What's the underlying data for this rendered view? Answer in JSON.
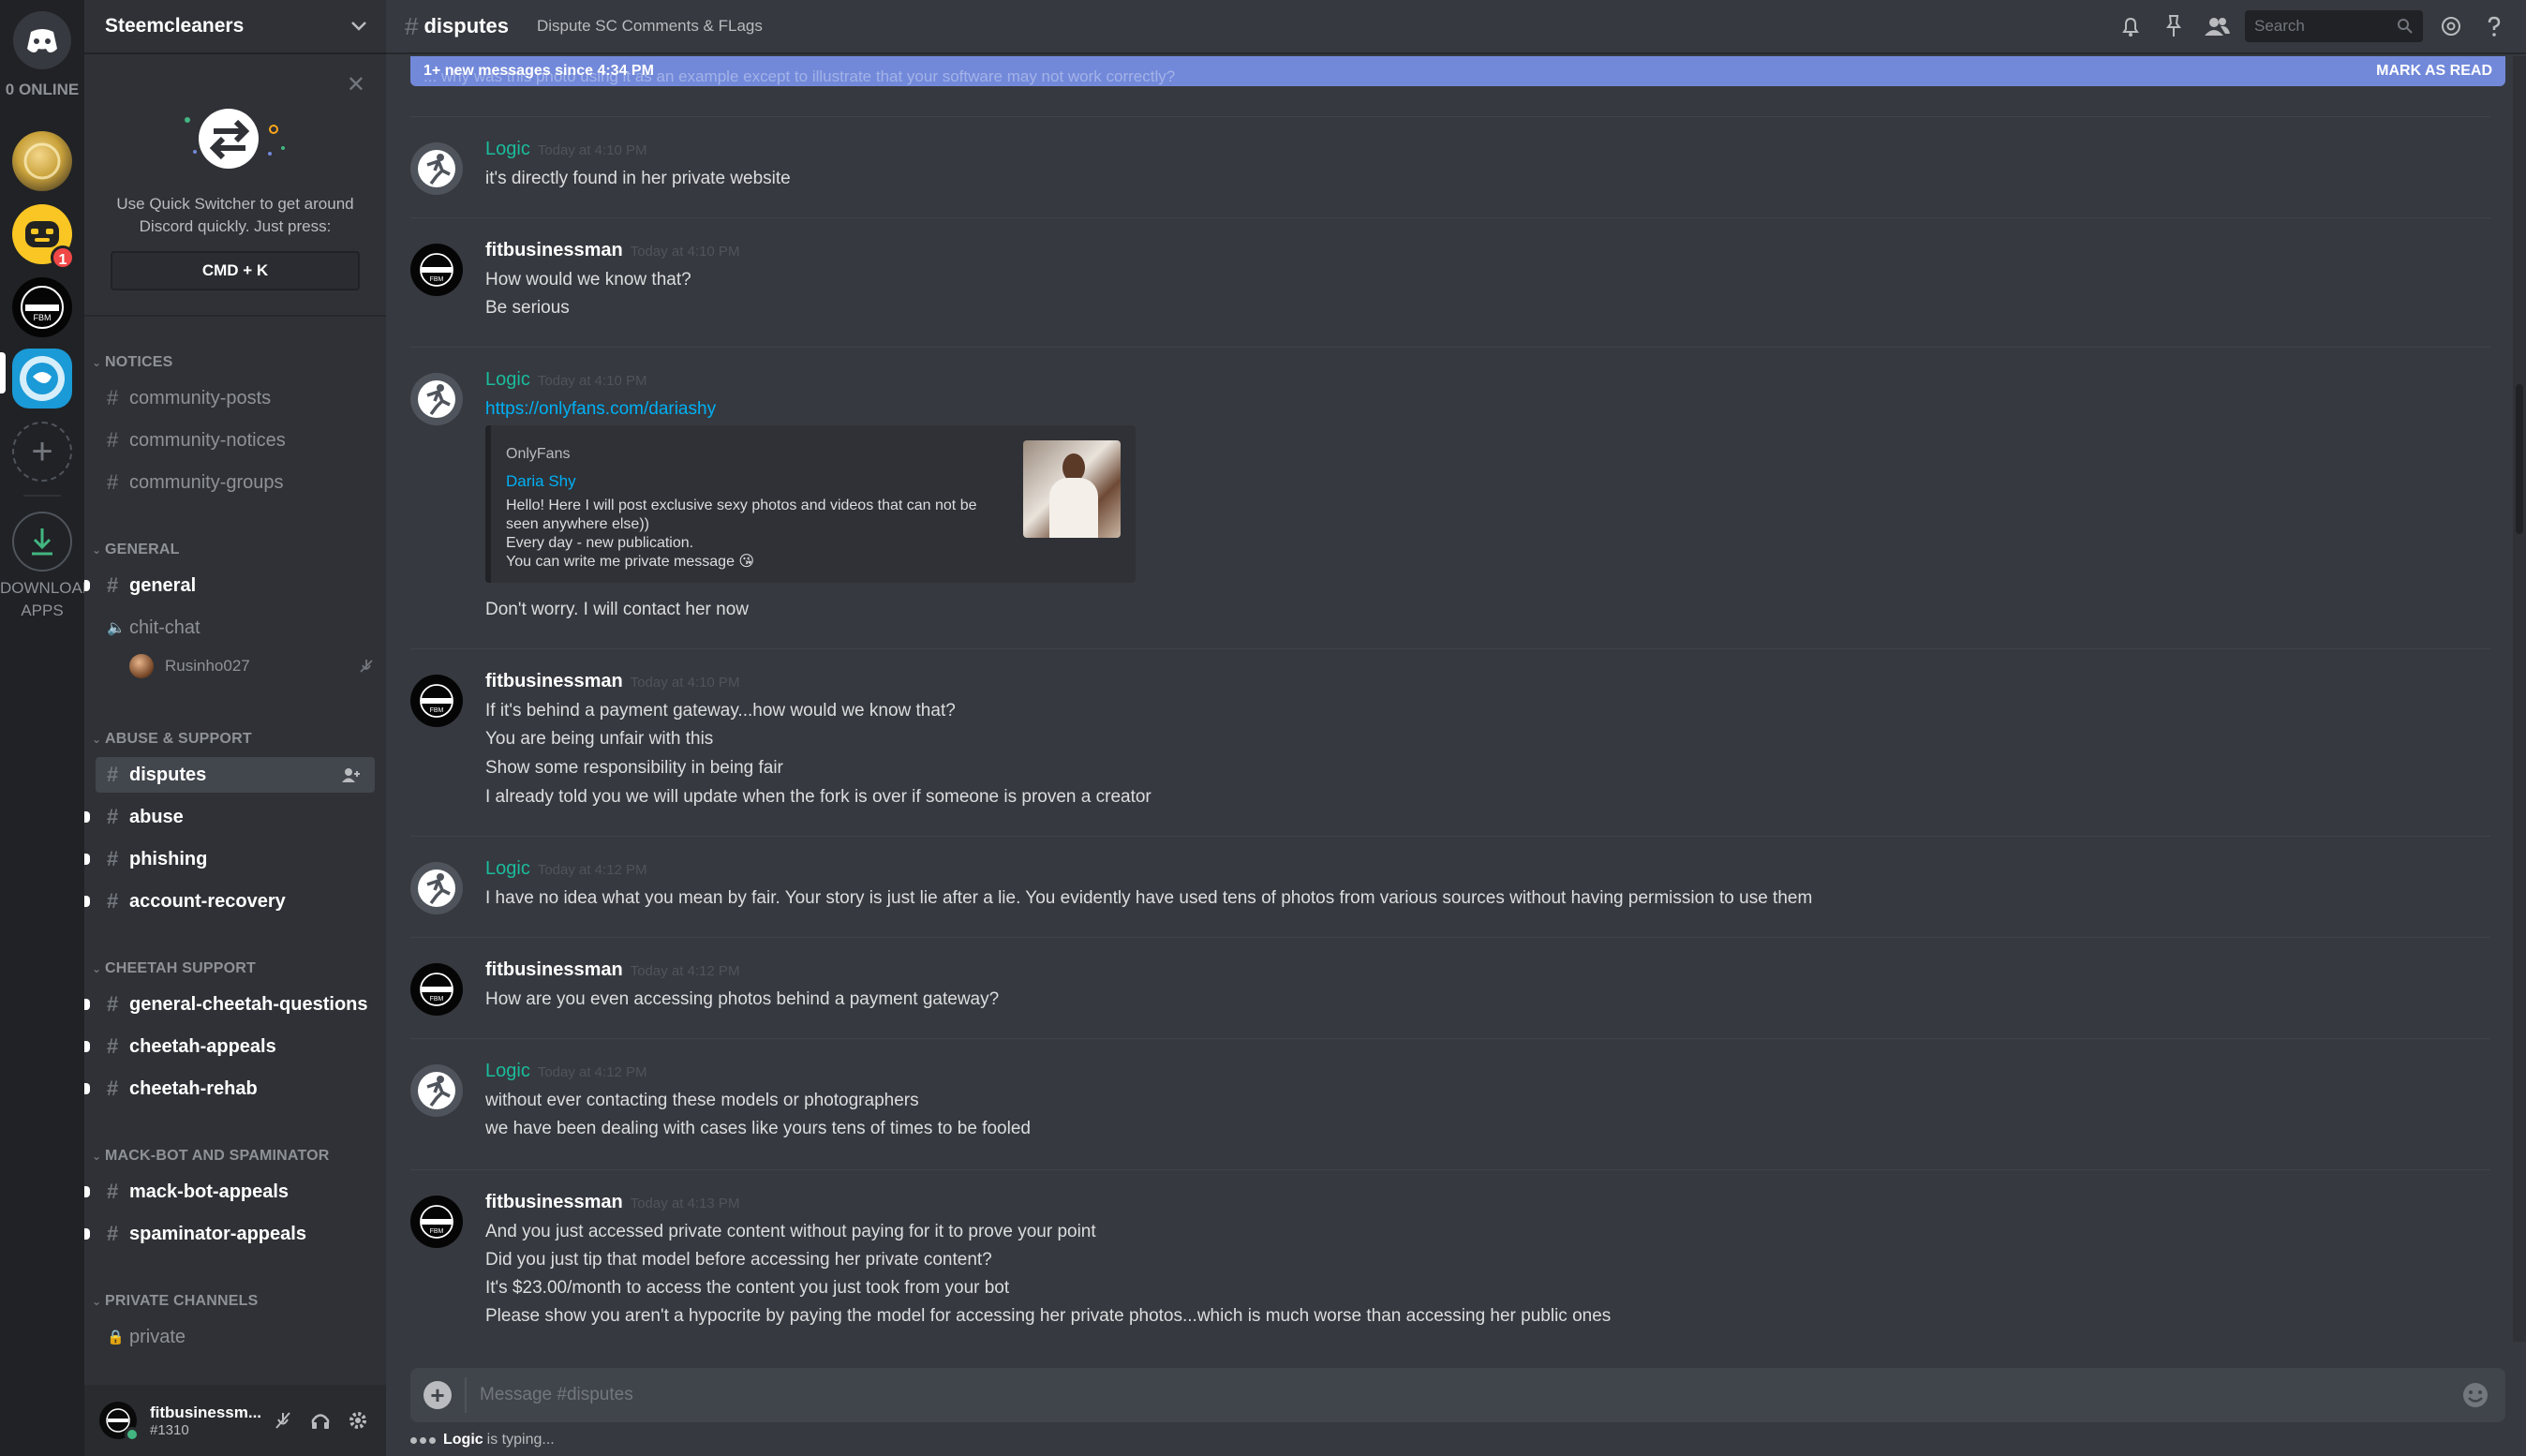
{
  "rail": {
    "online_label": "0 ONLINE",
    "badge_count": "1",
    "download_label": "DOWNLOAD\nAPPS"
  },
  "sidebar": {
    "guild_name": "Steemcleaners",
    "quick_switcher": {
      "text": "Use Quick Switcher to get around Discord quickly. Just press:",
      "shortcut": "CMD + K"
    },
    "categories": {
      "notices": "NOTICES",
      "general": "GENERAL",
      "abuse_support": "ABUSE & SUPPORT",
      "cheetah_support": "CHEETAH SUPPORT",
      "mack_bot": "MACK-BOT AND SPAMINATOR",
      "private_channels": "PRIVATE CHANNELS"
    },
    "channels": {
      "community_posts": "community-posts",
      "community_notices": "community-notices",
      "community_groups": "community-groups",
      "general": "general",
      "chit_chat": "chit-chat",
      "disputes": "disputes",
      "abuse": "abuse",
      "phishing": "phishing",
      "account_recovery": "account-recovery",
      "general_cheetah_questions": "general-cheetah-questions",
      "cheetah_appeals": "cheetah-appeals",
      "cheetah_rehab": "cheetah-rehab",
      "mack_bot_appeals": "mack-bot-appeals",
      "spaminator_appeals": "spaminator-appeals",
      "private": "private"
    },
    "voice_user": "Rusinho027",
    "user": {
      "name": "fitbusinessm...",
      "tag": "#1310"
    }
  },
  "header": {
    "channel": "disputes",
    "topic": "Dispute SC Comments & FLags",
    "search_placeholder": "Search"
  },
  "new_messages": {
    "label": "1+ new messages since 4:34 PM",
    "action": "MARK AS READ",
    "ghost_text": "... why was this photo using it as an example except to illustrate that your software may not work correctly?"
  },
  "messages": [
    {
      "author": "Logic",
      "time": "Today at 4:10 PM",
      "lines": [
        "it's directly found in her private website"
      ]
    },
    {
      "author": "fitbusinessman",
      "time": "Today at 4:10 PM",
      "lines": [
        "How would we know that?",
        "Be serious"
      ]
    },
    {
      "author": "Logic",
      "time": "Today at 4:10 PM",
      "link": "https://onlyfans.com/dariashy",
      "after": "Don't worry. I will contact her now"
    },
    {
      "author": "fitbusinessman",
      "time": "Today at 4:10 PM",
      "lines": [
        "If it's behind a payment gateway...how would we know that?",
        "You are being unfair with this",
        "Show some responsibility in being fair",
        "I already told you we will update when the fork is over if someone is proven a creator"
      ]
    },
    {
      "author": "Logic",
      "time": "Today at 4:12 PM",
      "lines": [
        "I have no idea what you mean by fair. Your story is just lie after a lie. You evidently have used tens of photos from various sources without having permission to use them"
      ]
    },
    {
      "author": "fitbusinessman",
      "time": "Today at 4:12 PM",
      "lines": [
        "How are you even accessing photos behind a payment gateway?"
      ]
    },
    {
      "author": "Logic",
      "time": "Today at 4:12 PM",
      "lines": [
        "without ever contacting these models or photographers",
        "we have been dealing with cases like yours tens of times to be fooled"
      ]
    },
    {
      "author": "fitbusinessman",
      "time": "Today at 4:13 PM",
      "lines": [
        "And you just accessed private content without paying for it to prove your point",
        "Did you just tip that model before accessing her private content?",
        "It's $23.00/month to access the content you just took from your bot",
        "Please show you aren't a hypocrite by paying the model for accessing her private photos...which is much worse than accessing her public ones"
      ]
    }
  ],
  "embed": {
    "provider": "OnlyFans",
    "title": "Daria Shy",
    "description": "Hello! Here I will post exclusive sexy photos and videos that can not be seen anywhere else))\nEvery day - new publication.\nYou can write me private message 😘"
  },
  "composer": {
    "placeholder": "Message #disputes"
  },
  "typing": {
    "user": "Logic",
    "suffix": "is typing..."
  },
  "colors": {
    "accent": "#7289da",
    "logic_name": "#1abc9c",
    "link": "#00b0f4",
    "online": "#43b581",
    "badge": "#f04747"
  }
}
